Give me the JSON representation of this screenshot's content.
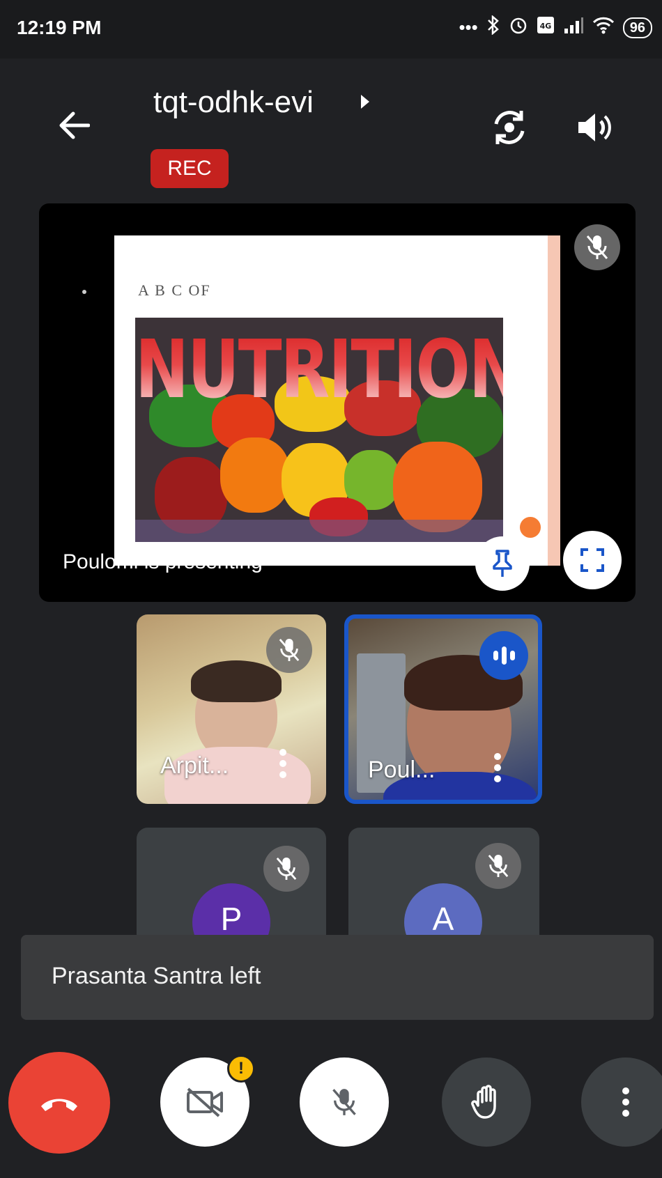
{
  "status_bar": {
    "time": "12:19 PM",
    "icons": [
      "more-dots-icon",
      "bluetooth-icon",
      "alarm-icon",
      "volte-icon",
      "signal-icon",
      "wifi-icon"
    ],
    "battery": "96"
  },
  "header": {
    "meeting_code": "tqt-odhk-evi",
    "recording_badge": "REC"
  },
  "presentation": {
    "slide_subtitle": "A B C OF",
    "slide_heading": "NUTRITION",
    "presenting_label": "Poulomi is presenting",
    "pin_indicator_color": "#f57c33"
  },
  "participants": [
    {
      "name": "Arpit...",
      "mic": "muted"
    },
    {
      "name": "Poul...",
      "mic": "speaking"
    },
    {
      "initial": "P",
      "mic": "muted",
      "avatar_color": "#5b2fa8"
    },
    {
      "initial": "A",
      "mic": "muted",
      "avatar_color": "#5c6bc0"
    }
  ],
  "toast": {
    "message": "Prasanta Santra left"
  },
  "controls": {
    "camera_badge": "!",
    "end_call_color": "#ea4335"
  }
}
